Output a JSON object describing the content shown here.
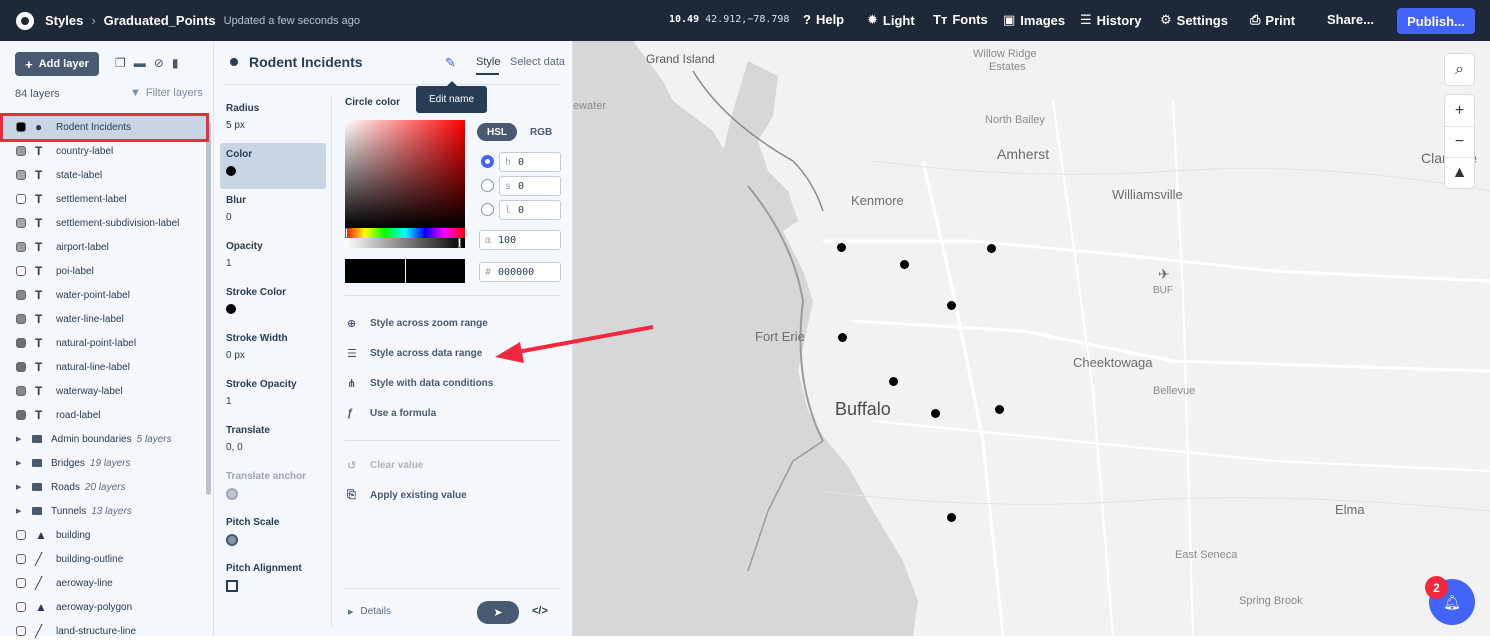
{
  "topbar": {
    "app": "Styles",
    "separator": ">",
    "style_name": "Graduated_Points",
    "updated": "Updated a few seconds ago",
    "zoom": "10.49",
    "coords": "42.912,−78.798",
    "help": "Help",
    "light": "Light",
    "fonts": "Fonts",
    "images": "Images",
    "history": "History",
    "settings": "Settings",
    "print": "Print",
    "share": "Share...",
    "publish": "Publish..."
  },
  "sidebar": {
    "add_layer": "Add layer",
    "layer_count": "84 layers",
    "filter": "Filter layers",
    "layers": [
      {
        "name": "Rodent Incidents",
        "kind": "circle",
        "swatch": "#000000",
        "selected": true
      },
      {
        "name": "country-label",
        "kind": "symbol",
        "swatch": "#9c9c9c"
      },
      {
        "name": "state-label",
        "kind": "symbol",
        "swatch": "#a8a8a8"
      },
      {
        "name": "settlement-label",
        "kind": "symbol",
        "swatch": "#ffffff"
      },
      {
        "name": "settlement-subdivision-label",
        "kind": "symbol",
        "swatch": "#a8a8a8"
      },
      {
        "name": "airport-label",
        "kind": "symbol",
        "swatch": "#9c9c9c"
      },
      {
        "name": "poi-label",
        "kind": "symbol",
        "swatch": "#f4f7fb"
      },
      {
        "name": "water-point-label",
        "kind": "symbol",
        "swatch": "#7f8a8a"
      },
      {
        "name": "water-line-label",
        "kind": "symbol",
        "swatch": "#7f8a8a"
      },
      {
        "name": "natural-point-label",
        "kind": "symbol",
        "swatch": "#6d6d6d"
      },
      {
        "name": "natural-line-label",
        "kind": "symbol",
        "swatch": "#6d6d6d"
      },
      {
        "name": "waterway-label",
        "kind": "symbol",
        "swatch": "#7f8a8a"
      },
      {
        "name": "road-label",
        "kind": "symbol",
        "swatch": "#6d6d6d"
      },
      {
        "name": "Admin boundaries",
        "kind": "group",
        "count": "5 layers"
      },
      {
        "name": "Bridges",
        "kind": "group",
        "count": "19 layers"
      },
      {
        "name": "Roads",
        "kind": "group",
        "count": "20 layers"
      },
      {
        "name": "Tunnels",
        "kind": "group",
        "count": "13 layers"
      },
      {
        "name": "building",
        "kind": "fill",
        "swatch": "#f0f0f0"
      },
      {
        "name": "building-outline",
        "kind": "line",
        "swatch": "#f0f0f0"
      },
      {
        "name": "aeroway-line",
        "kind": "line",
        "swatch": "#f4f7fb"
      },
      {
        "name": "aeroway-polygon",
        "kind": "fill",
        "swatch": "#f4f7fb"
      },
      {
        "name": "land-structure-line",
        "kind": "line",
        "swatch": "#f4f7fb"
      }
    ]
  },
  "panel": {
    "title": "Rodent Incidents",
    "tab_style": "Style",
    "tab_select": "Select data",
    "tooltip": "Edit name",
    "properties": [
      {
        "label": "Radius",
        "value": "5 px"
      },
      {
        "label": "Color",
        "value": "",
        "swatch": "#000000",
        "active": true
      },
      {
        "label": "Blur",
        "value": "0"
      },
      {
        "label": "Opacity",
        "value": "1"
      },
      {
        "label": "Stroke Color",
        "value": "",
        "swatch": "#000000"
      },
      {
        "label": "Stroke Width",
        "value": "0 px"
      },
      {
        "label": "Stroke Opacity",
        "value": "1"
      },
      {
        "label": "Translate",
        "value": "0, 0"
      },
      {
        "label": "Translate anchor",
        "value": "",
        "muted": true,
        "icon": "globe-icon"
      },
      {
        "label": "Pitch Scale",
        "value": "",
        "icon": "globe-icon"
      },
      {
        "label": "Pitch Alignment",
        "value": "",
        "icon": "frame-icon"
      }
    ],
    "editor": {
      "label": "Circle color",
      "mode_hsl": "HSL",
      "mode_rgb": "RGB",
      "h_prefix": "h",
      "h": "0",
      "s_prefix": "s",
      "s": "0",
      "l_prefix": "l",
      "l": "0",
      "alpha_prefix": "α",
      "alpha": "100",
      "hex_prefix": "#",
      "hex": "000000",
      "options": [
        {
          "label": "Style across zoom range",
          "icon": "zoom-range-icon"
        },
        {
          "label": "Style across data range",
          "icon": "data-range-icon"
        },
        {
          "label": "Style with data conditions",
          "icon": "conditions-icon"
        },
        {
          "label": "Use a formula",
          "icon": "formula-icon"
        }
      ],
      "clear_value": "Clear value",
      "apply_existing": "Apply existing value"
    },
    "details": "Details"
  },
  "map": {
    "labels": {
      "grand_island": "Grand Island",
      "willow_ridge": "Willow Ridge",
      "estates": "Estates",
      "north_bailey": "North Bailey",
      "amherst": "Amherst",
      "clarence": "Clarence",
      "williamsville": "Williamsville",
      "kenmore": "Kenmore",
      "buf": "BUF",
      "fort_erie": "Fort Erie",
      "cheektowaga": "Cheektowaga",
      "bellevue": "Bellevue",
      "buffalo": "Buffalo",
      "elma": "Elma",
      "east_seneca": "East Seneca",
      "spring_brook": "Spring Brook",
      "water": "ewater"
    },
    "notification_count": "2"
  },
  "colors": {
    "accent": "#4264fb",
    "highlight": "#f3283c",
    "topbar": "#1d2838",
    "selected_row": "#c8d5e6"
  }
}
